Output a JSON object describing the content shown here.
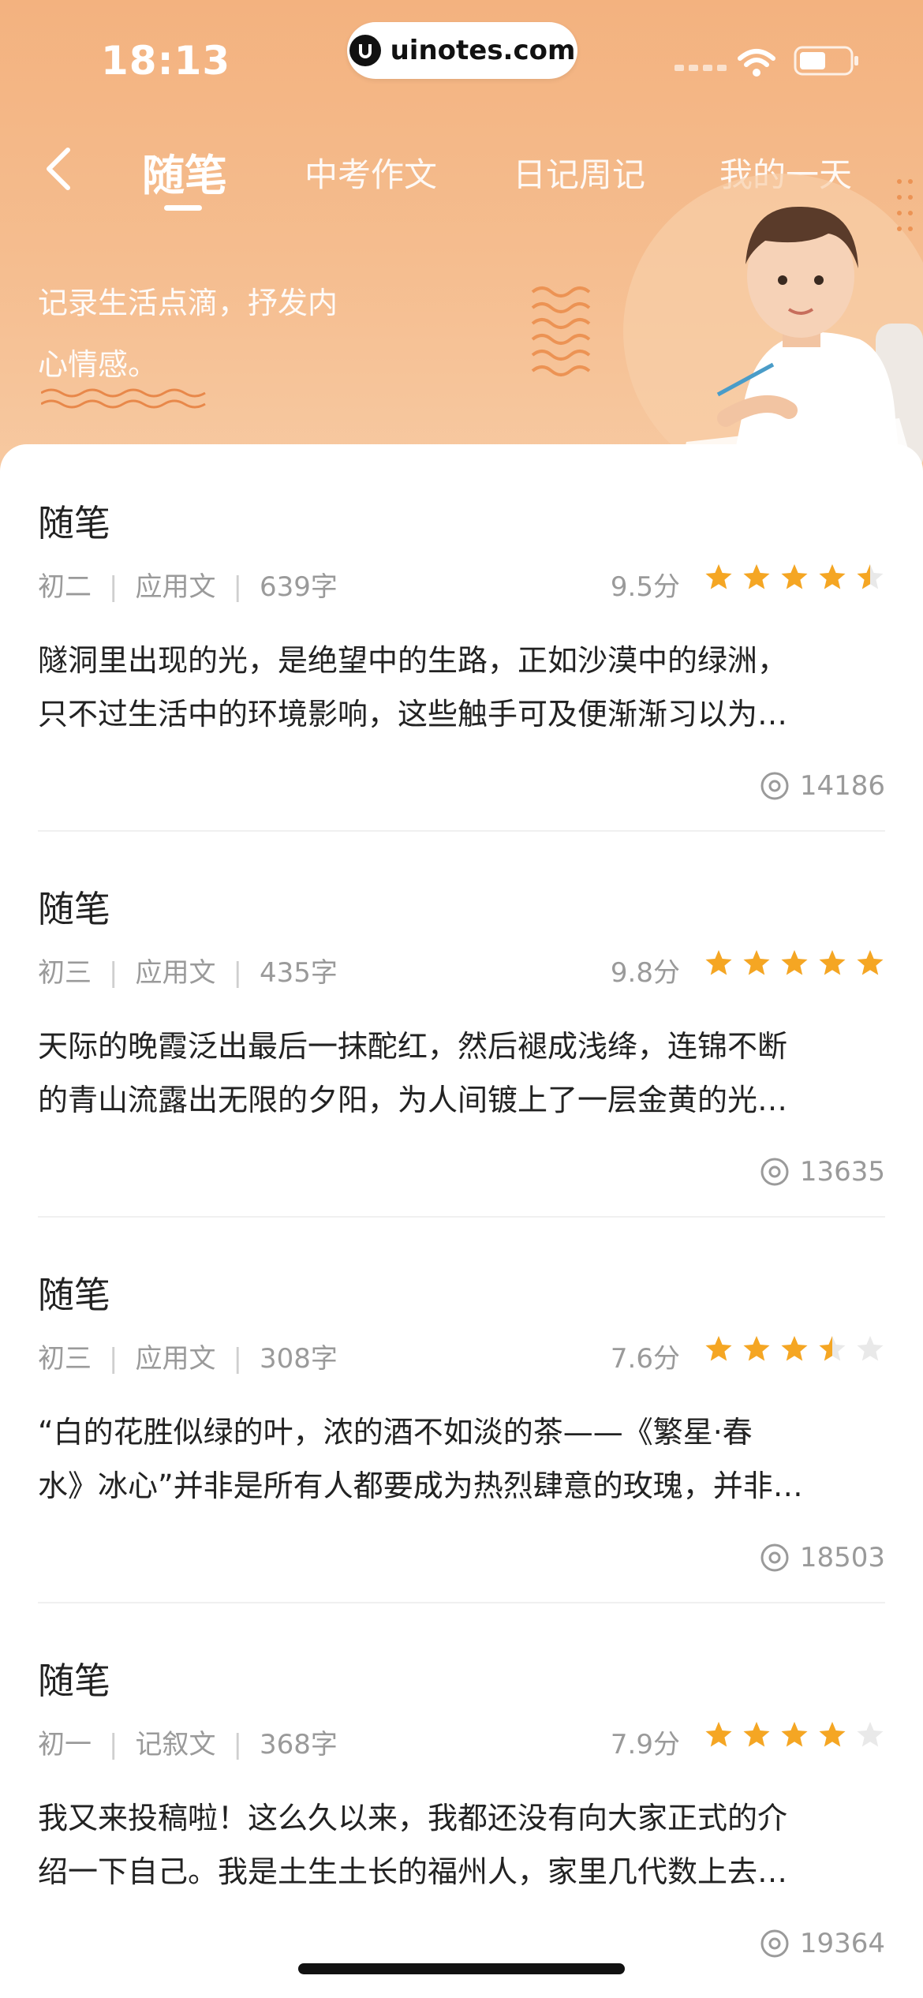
{
  "status_bar": {
    "time": "18:13",
    "watermark": "uinotes.com"
  },
  "nav": {
    "tabs": [
      {
        "label": "随笔",
        "active": true
      },
      {
        "label": "中考作文",
        "active": false
      },
      {
        "label": "日记周记",
        "active": false
      },
      {
        "label": "我的一天",
        "active": false
      }
    ]
  },
  "banner": {
    "slogan_line1": "记录生活点滴，抒发内",
    "slogan_line2": "心情感。"
  },
  "colors": {
    "accent": "#f5a623",
    "header": "#f3b27f",
    "star_empty": "#e9e9e9"
  },
  "essays": [
    {
      "title": "随笔",
      "grade": "初二",
      "genre": "应用文",
      "words": "639字",
      "score": "9.5分",
      "rating": 4.5,
      "excerpt_line1": "隧洞里出现的光，是绝望中的生路，正如沙漠中的绿洲，",
      "excerpt_line2": "只不过生活中的环境影响，这些触手可及便渐渐习以为…",
      "views": "14186"
    },
    {
      "title": "随笔",
      "grade": "初三",
      "genre": "应用文",
      "words": "435字",
      "score": "9.8分",
      "rating": 5,
      "excerpt_line1": "天际的晚霞泛出最后一抹酡红，然后褪成浅绛，连锦不断",
      "excerpt_line2": "的青山流露出无限的夕阳，为人间镀上了一层金黄的光…",
      "views": "13635"
    },
    {
      "title": "随笔",
      "grade": "初三",
      "genre": "应用文",
      "words": "308字",
      "score": "7.6分",
      "rating": 3.5,
      "excerpt_line1": "“白的花胜似绿的叶，浓的酒不如淡的茶——《繁星·春",
      "excerpt_line2": "水》冰心”并非是所有人都要成为热烈肆意的玫瑰，并非…",
      "views": "18503"
    },
    {
      "title": "随笔",
      "grade": "初一",
      "genre": "记叙文",
      "words": "368字",
      "score": "7.9分",
      "rating": 4,
      "excerpt_line1": "我又来投稿啦！这么久以来，我都还没有向大家正式的介",
      "excerpt_line2": "绍一下自己。我是土生土长的福州人，家里几代数上去…",
      "views": "19364"
    }
  ]
}
